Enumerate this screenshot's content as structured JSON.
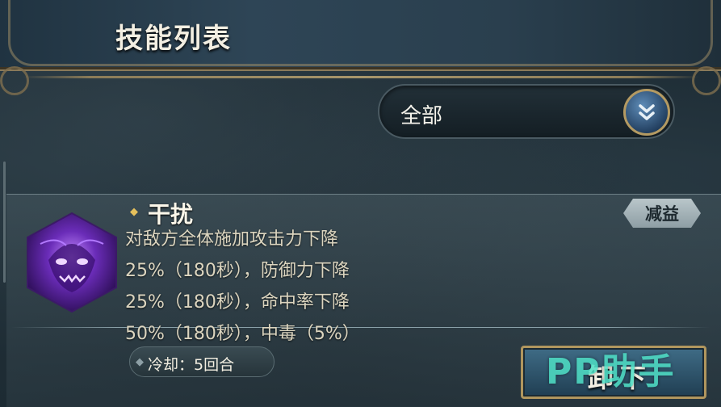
{
  "header": {
    "title": "技能列表"
  },
  "filter": {
    "selected": "全部"
  },
  "skill": {
    "name": "干扰",
    "type_tag": "减益",
    "description": [
      "对敌方全体施加攻击力下降",
      "25%（180秒），防御力下降",
      "25%（180秒），命中率下降",
      "50%（180秒），中毒（5%）"
    ],
    "cooldown": "冷却：5回合",
    "action_label": "卸下"
  },
  "watermark": "PP助手",
  "icons": [
    "dropdown-chevron-icon",
    "skill-icon",
    "star-icon",
    "diamond-icon"
  ]
}
